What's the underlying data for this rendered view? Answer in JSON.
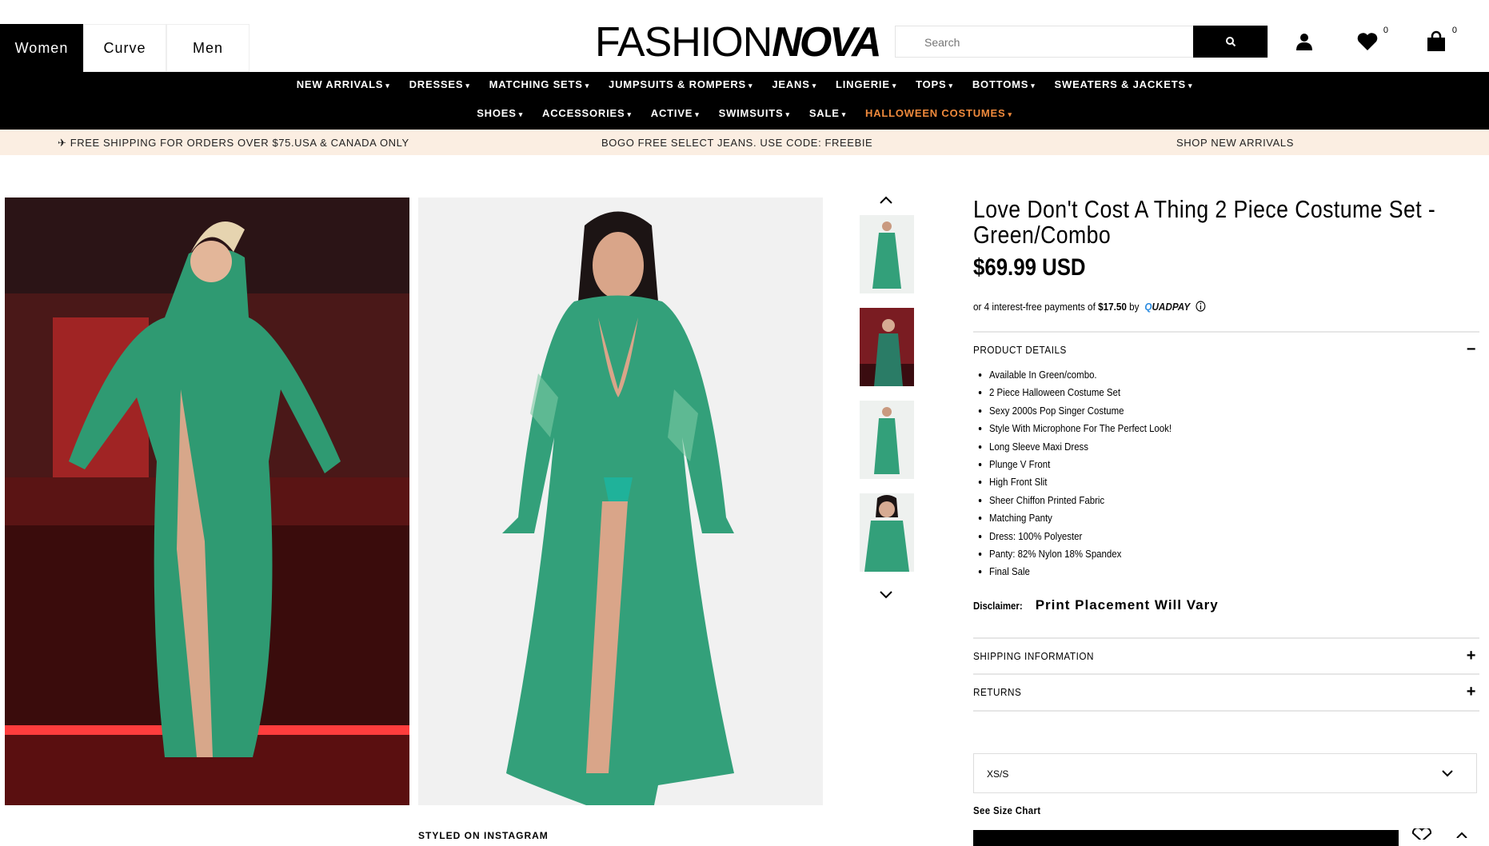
{
  "header": {
    "gender_tabs": [
      "Women",
      "Curve",
      "Men"
    ],
    "active_tab": "Women",
    "logo_thin": "FASHION",
    "logo_bold": "NOVA",
    "search_placeholder": "Search",
    "wishlist_count": "0",
    "cart_count": "0"
  },
  "nav": {
    "row1": [
      "NEW ARRIVALS",
      "DRESSES",
      "MATCHING SETS",
      "JUMPSUITS & ROMPERS",
      "JEANS",
      "LINGERIE",
      "TOPS",
      "BOTTOMS",
      "SWEATERS & JACKETS"
    ],
    "row2": [
      "SHOES",
      "ACCESSORIES",
      "ACTIVE",
      "SWIMSUITS",
      "SALE",
      "HALLOWEEN COSTUMES"
    ],
    "highlight_color": "#f08a3c"
  },
  "promo": {
    "shipping": "✈ FREE SHIPPING FOR ORDERS OVER $75.USA & CANADA ONLY",
    "bogo": "BOGO FREE SELECT JEANS. USE CODE: FREEBIE",
    "shop_new": "SHOP NEW ARRIVALS"
  },
  "product": {
    "title": "Love Don't Cost A Thing 2 Piece Costume Set - Green/Combo",
    "price": "$69.99 USD",
    "installments_prefix": "or 4 interest-free payments of",
    "installment_amount": "$17.50",
    "installments_by": "by",
    "quadpay_q": "Q",
    "quadpay_rest": "UADPAY",
    "details_heading": "PRODUCT DETAILS",
    "details": [
      "Available In Green/combo.",
      "2 Piece Halloween Costume Set",
      "Sexy 2000s Pop Singer Costume",
      "Style With Microphone For The Perfect Look!",
      "Long Sleeve Maxi Dress",
      "Plunge V Front",
      "High Front Slit",
      "Sheer Chiffon Printed Fabric",
      "Matching Panty",
      "Dress: 100% Polyester",
      "Panty: 82% Nylon 18% Spandex",
      "Final Sale"
    ],
    "disclaimer_label": "Disclaimer:",
    "disclaimer_value": "Print Placement Will Vary",
    "shipping_heading": "SHIPPING INFORMATION",
    "returns_heading": "RETURNS",
    "selected_size": "XS/S",
    "size_chart_link": "See Size Chart"
  },
  "gallery": {
    "styled_on_instagram": "STYLED ON INSTAGRAM"
  },
  "colors": {
    "dress_green": "#2f9a72",
    "dress_light": "#7cc9a4",
    "bar_red": "#8c1c1c"
  }
}
